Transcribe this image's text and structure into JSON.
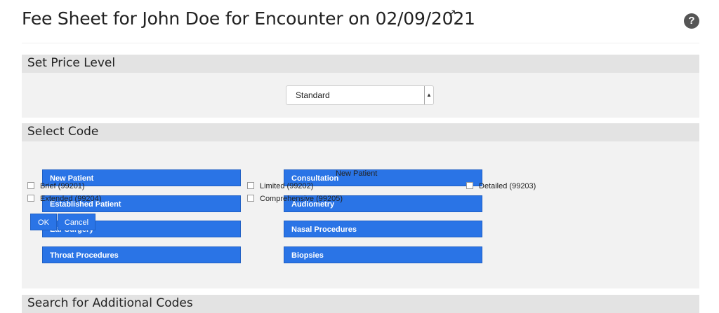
{
  "header": {
    "title": "Fee Sheet for John Doe for Encounter on 02/09/2021",
    "expand_icon": "↗",
    "help_icon": "?"
  },
  "price_level": {
    "heading": "Set Price Level",
    "selected": "Standard"
  },
  "select_code": {
    "heading": "Select Code",
    "categories": [
      "New Patient",
      "Consultation",
      "Established Patient",
      "Audiometry",
      "Ear Surgery",
      "Nasal Procedures",
      "Throat Procedures",
      "Biopsies"
    ]
  },
  "popup": {
    "title": "New Patient",
    "options": [
      "Brief (99201)",
      "Limited (99202)",
      "Detailed (99203)",
      "Extended (99204)",
      "Comprehensive (99205)"
    ],
    "ok_label": "OK",
    "cancel_label": "Cancel"
  },
  "additional": {
    "heading": "Search for Additional Codes"
  }
}
